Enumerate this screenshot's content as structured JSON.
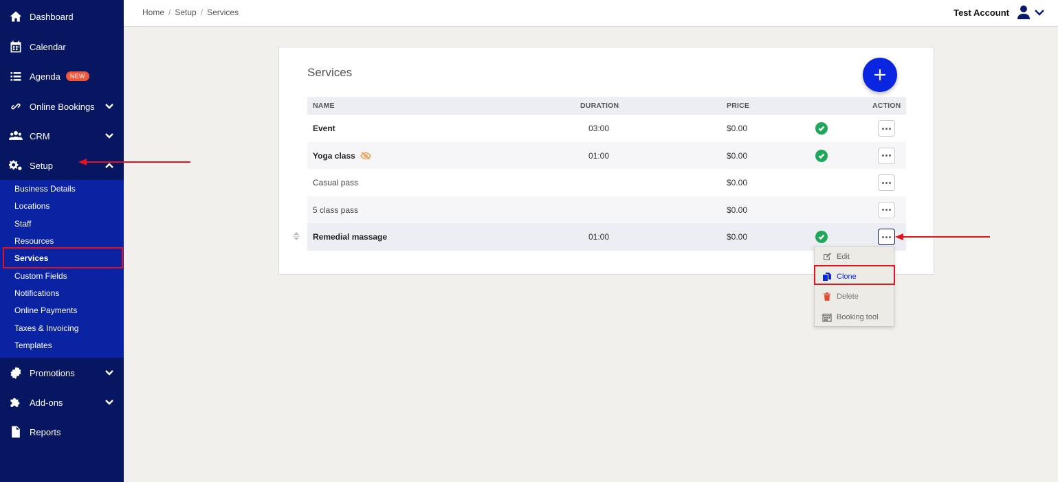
{
  "sidebar": {
    "items": [
      {
        "label": "Dashboard",
        "icon": "home-icon"
      },
      {
        "label": "Calendar",
        "icon": "calendar-icon"
      },
      {
        "label": "Agenda",
        "icon": "list-icon",
        "badge": "NEW"
      },
      {
        "label": "Online Bookings",
        "icon": "link-icon",
        "chevron": "down"
      },
      {
        "label": "CRM",
        "icon": "users-icon",
        "chevron": "down"
      },
      {
        "label": "Setup",
        "icon": "gears-icon",
        "chevron": "up"
      },
      {
        "label": "Promotions",
        "icon": "badge-icon",
        "chevron": "down"
      },
      {
        "label": "Add-ons",
        "icon": "puzzle-icon",
        "chevron": "down"
      },
      {
        "label": "Reports",
        "icon": "file-icon"
      }
    ],
    "setup_submenu": [
      "Business Details",
      "Locations",
      "Staff",
      "Resources",
      "Services",
      "Custom Fields",
      "Notifications",
      "Online Payments",
      "Taxes & Invoicing",
      "Templates"
    ],
    "active_sub": "Services"
  },
  "breadcrumb": [
    "Home",
    "Setup",
    "Services"
  ],
  "account": {
    "name": "Test Account"
  },
  "card": {
    "title": "Services",
    "columns": {
      "name": "NAME",
      "duration": "DURATION",
      "price": "PRICE",
      "action": "ACTION"
    },
    "rows": [
      {
        "name": "Event",
        "duration": "03:00",
        "price": "$0.00",
        "active": true,
        "hidden": false
      },
      {
        "name": "Yoga class",
        "duration": "01:00",
        "price": "$0.00",
        "active": true,
        "hidden": true
      },
      {
        "name": "Casual pass",
        "duration": "",
        "price": "$0.00",
        "active": false,
        "hidden": false
      },
      {
        "name": "5 class pass",
        "duration": "",
        "price": "$0.00",
        "active": false,
        "hidden": false
      },
      {
        "name": "Remedial massage",
        "duration": "01:00",
        "price": "$0.00",
        "active": true,
        "hidden": false
      }
    ]
  },
  "dropdown": {
    "items": [
      {
        "label": "Edit",
        "icon": "edit-icon"
      },
      {
        "label": "Clone",
        "icon": "clone-icon"
      },
      {
        "label": "Delete",
        "icon": "trash-icon"
      },
      {
        "label": "Booking tool",
        "icon": "calendar-grid-icon"
      }
    ]
  },
  "colors": {
    "sidebar": "#071660",
    "submenu": "#0a23a3",
    "accent": "#0a26e0",
    "success": "#1fa85a",
    "annotation": "#e2121f",
    "badge": "#f0573b"
  }
}
